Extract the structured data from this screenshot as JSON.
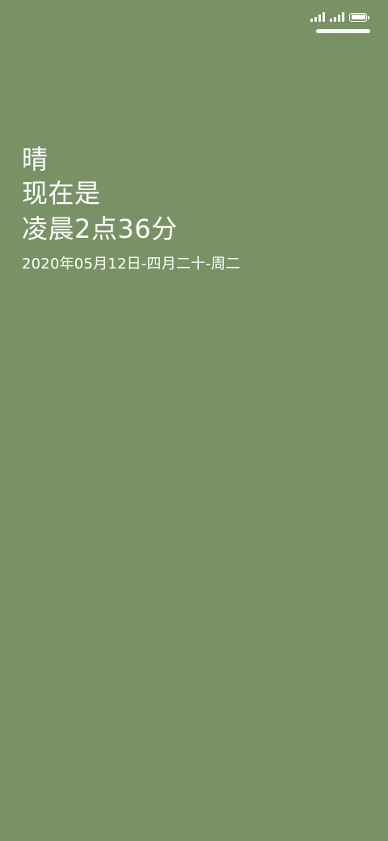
{
  "status_bar": {
    "signal_icon_1": "cellular-signal-icon",
    "signal_icon_2": "cellular-signal-icon",
    "battery_icon": "battery-icon",
    "battery_level": 1
  },
  "lock_screen": {
    "weather": "晴",
    "prefix": "现在是",
    "time_text": "凌晨2点36分",
    "date_text": "2020年05月12日-四月二十-周二"
  },
  "colors": {
    "background": "#799265",
    "text": "#ffffff"
  }
}
